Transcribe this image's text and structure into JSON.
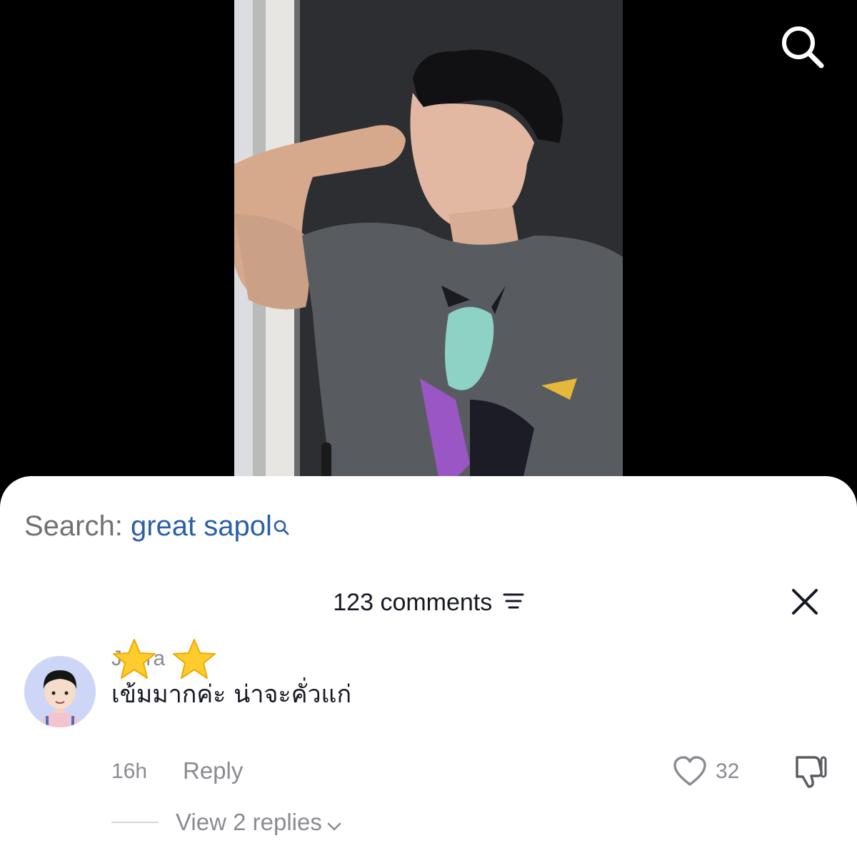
{
  "video": {
    "search_icon": "search-icon"
  },
  "sheet": {
    "search_prefix": "Search:",
    "search_term": "great sapol",
    "comments_count": "123 comments",
    "sort_icon": "sort-lines-icon",
    "close_icon": "close-icon"
  },
  "comment": {
    "username": "Jeera",
    "stars": "⭐⭐",
    "text": "เข้มมากค่ะ น่าจะคั่วแก่",
    "time": "16h",
    "reply_label": "Reply",
    "like_count": "32",
    "view_replies": "View 2 replies"
  },
  "colors": {
    "search_term": "#2b5fa8",
    "muted_text": "#8a8b91",
    "primary_text": "#161823",
    "sheet_bg": "#ffffff",
    "backdrop": "#000000"
  }
}
